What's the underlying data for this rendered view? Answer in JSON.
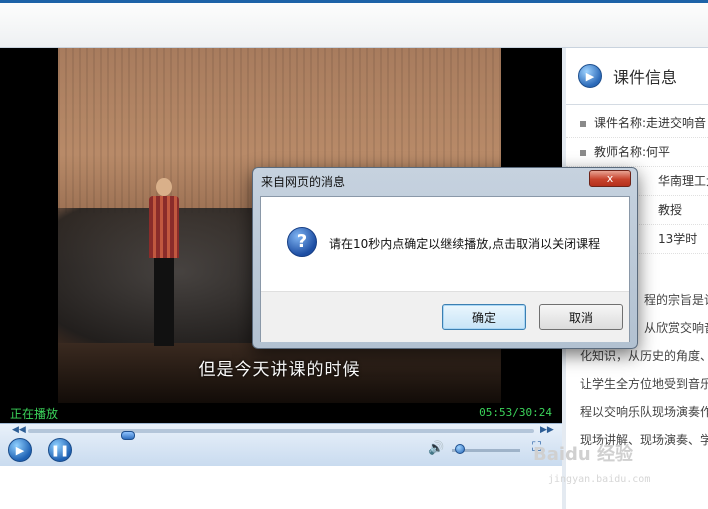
{
  "player": {
    "subtitle": "但是今天讲课的时候",
    "status": "正在播放",
    "time": "05:53/30:24",
    "progress": 0.19,
    "volume": 0.05
  },
  "sidebar": {
    "title": "课件信息",
    "rows": [
      {
        "label": "课件名称:",
        "value": "走进交响音"
      },
      {
        "label": "教师名称:",
        "value": "何平"
      },
      {
        "label": "",
        "value": "华南理工大"
      },
      {
        "label": "",
        "value": "教授"
      },
      {
        "label": "",
        "value": "13学时"
      }
    ],
    "desc_lines": [
      "程的宗旨是让",
      "从欣赏交响音",
      "化知识，从历史的角度、",
      "让学生全方位地受到音乐",
      "程以交响乐队现场演奏作",
      "现场讲解、现场演奏、学"
    ]
  },
  "dialog": {
    "title": "来自网页的消息",
    "message": "请在10秒内点确定以继续播放,点击取消以关闭课程",
    "ok": "确定",
    "cancel": "取消",
    "close_glyph": "x"
  },
  "watermark": {
    "main": "Baidu 经验",
    "sub": "jingyan.baidu.com"
  }
}
